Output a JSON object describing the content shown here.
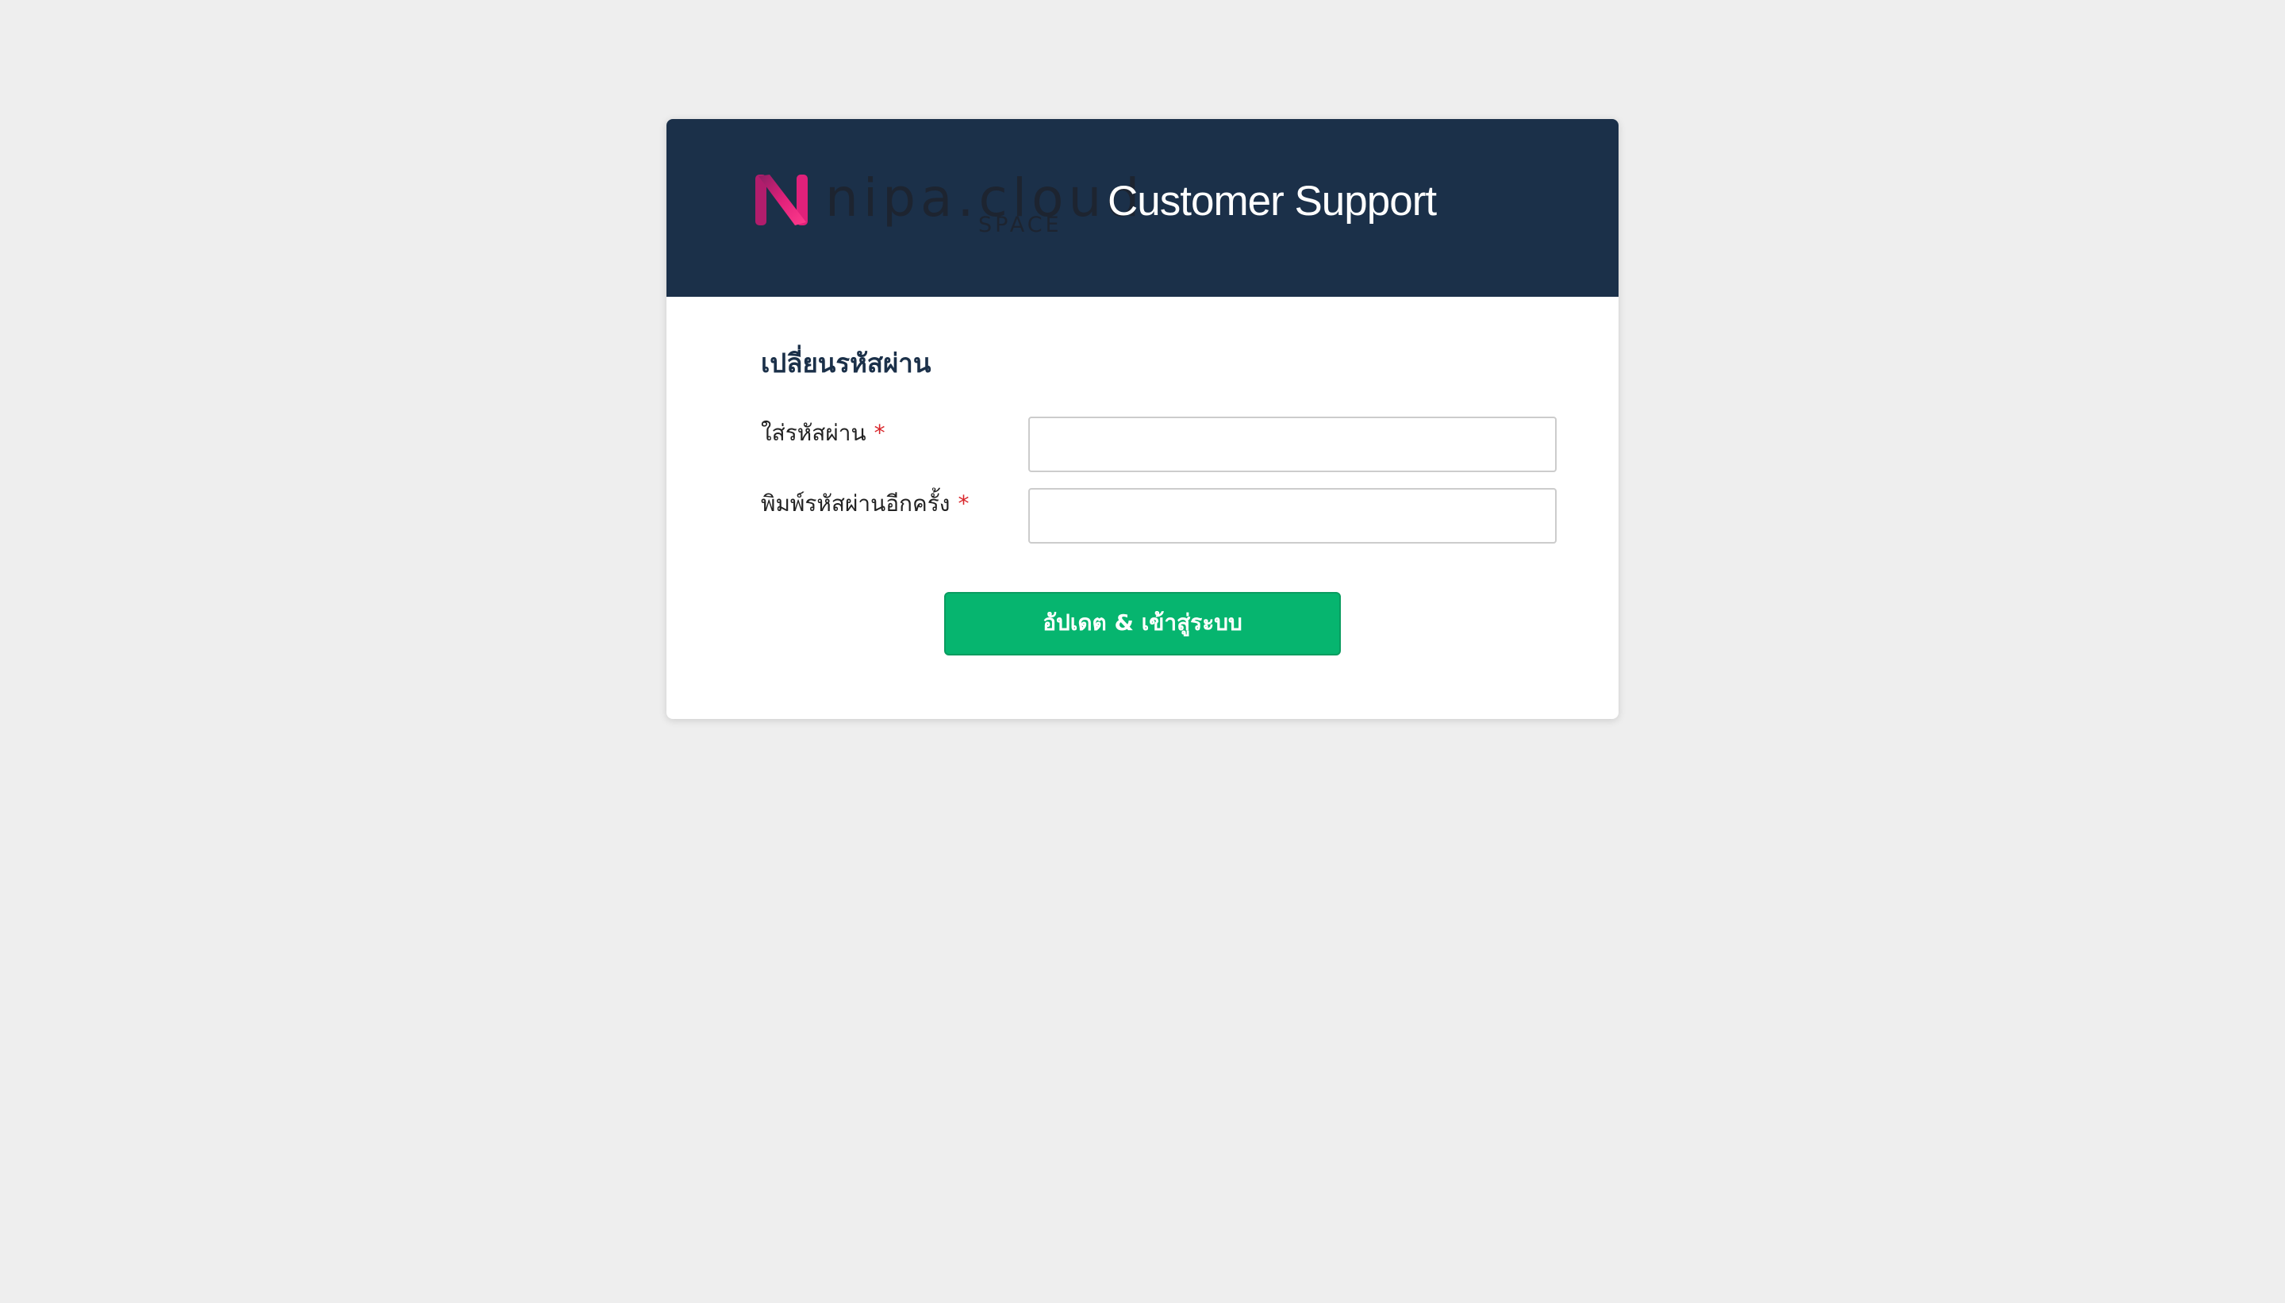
{
  "header": {
    "logo": {
      "icon": "nipa-n-logo-icon",
      "wordmark": "nipa.cloud",
      "sub": "SPACE"
    },
    "title": "Customer Support"
  },
  "form": {
    "title": "เปลี่ยนรหัสผ่าน",
    "fields": [
      {
        "label": "ใส่รหัสผ่าน",
        "required_mark": "*",
        "value": ""
      },
      {
        "label": "พิมพ์รหัสผ่านอีกครั้ง",
        "required_mark": "*",
        "value": ""
      }
    ],
    "submit_label": "อัปเดต & เข้าสู่ระบบ"
  },
  "colors": {
    "page_background": "#eeeeee",
    "header_background": "#1b3049",
    "brand_pink": "#e0217a",
    "button_green": "#06b56f",
    "required_red": "#d9262b"
  }
}
